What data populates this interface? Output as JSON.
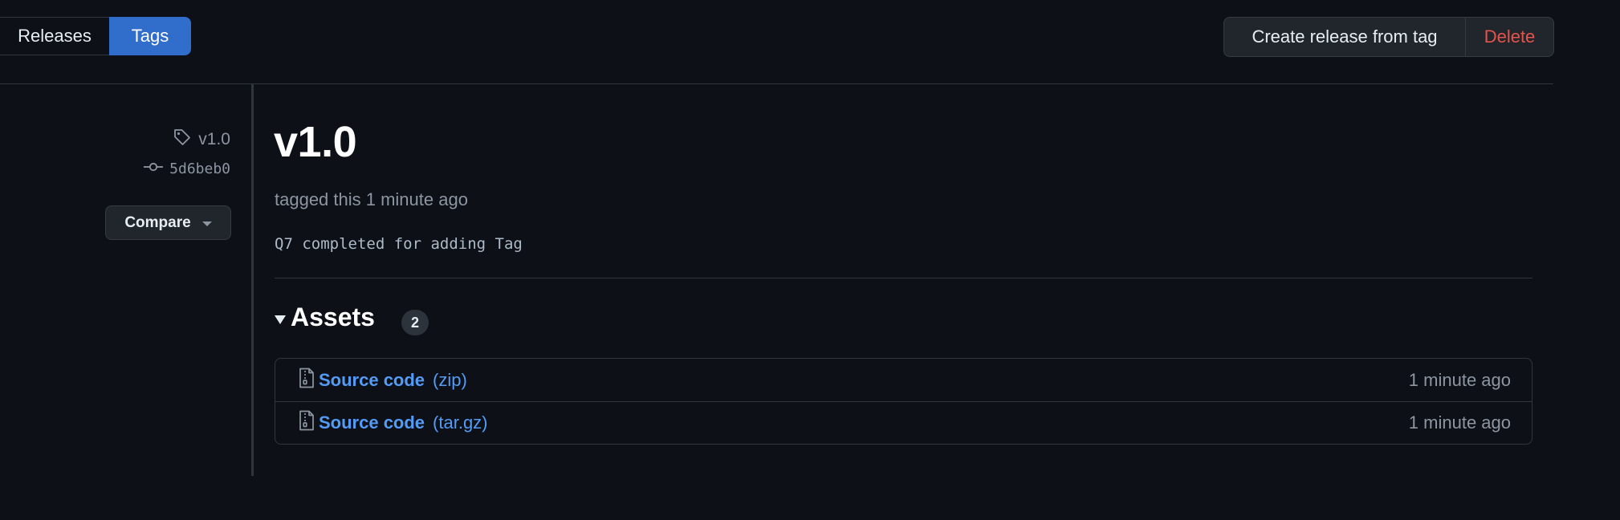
{
  "tabs": [
    {
      "label": "Releases",
      "active": false
    },
    {
      "label": "Tags",
      "active": true
    }
  ],
  "actions": {
    "create_label": "Create release from tag",
    "delete_label": "Delete"
  },
  "meta": {
    "tag": "v1.0",
    "commit": "5d6beb0",
    "compare_label": "Compare"
  },
  "release": {
    "title": "v1.0",
    "tagged_text": "tagged this 1 minute ago",
    "message": "Q7 completed for adding Tag"
  },
  "assets": {
    "title": "Assets",
    "count": "2",
    "items": [
      {
        "name": "Source code",
        "ext": "(zip)",
        "time": "1 minute ago"
      },
      {
        "name": "Source code",
        "ext": "(tar.gz)",
        "time": "1 minute ago"
      }
    ]
  },
  "colors": {
    "background": "#0d1117",
    "accent": "#316dca",
    "link": "#539bf5",
    "danger": "#e5534b",
    "muted": "#8d96a0"
  }
}
